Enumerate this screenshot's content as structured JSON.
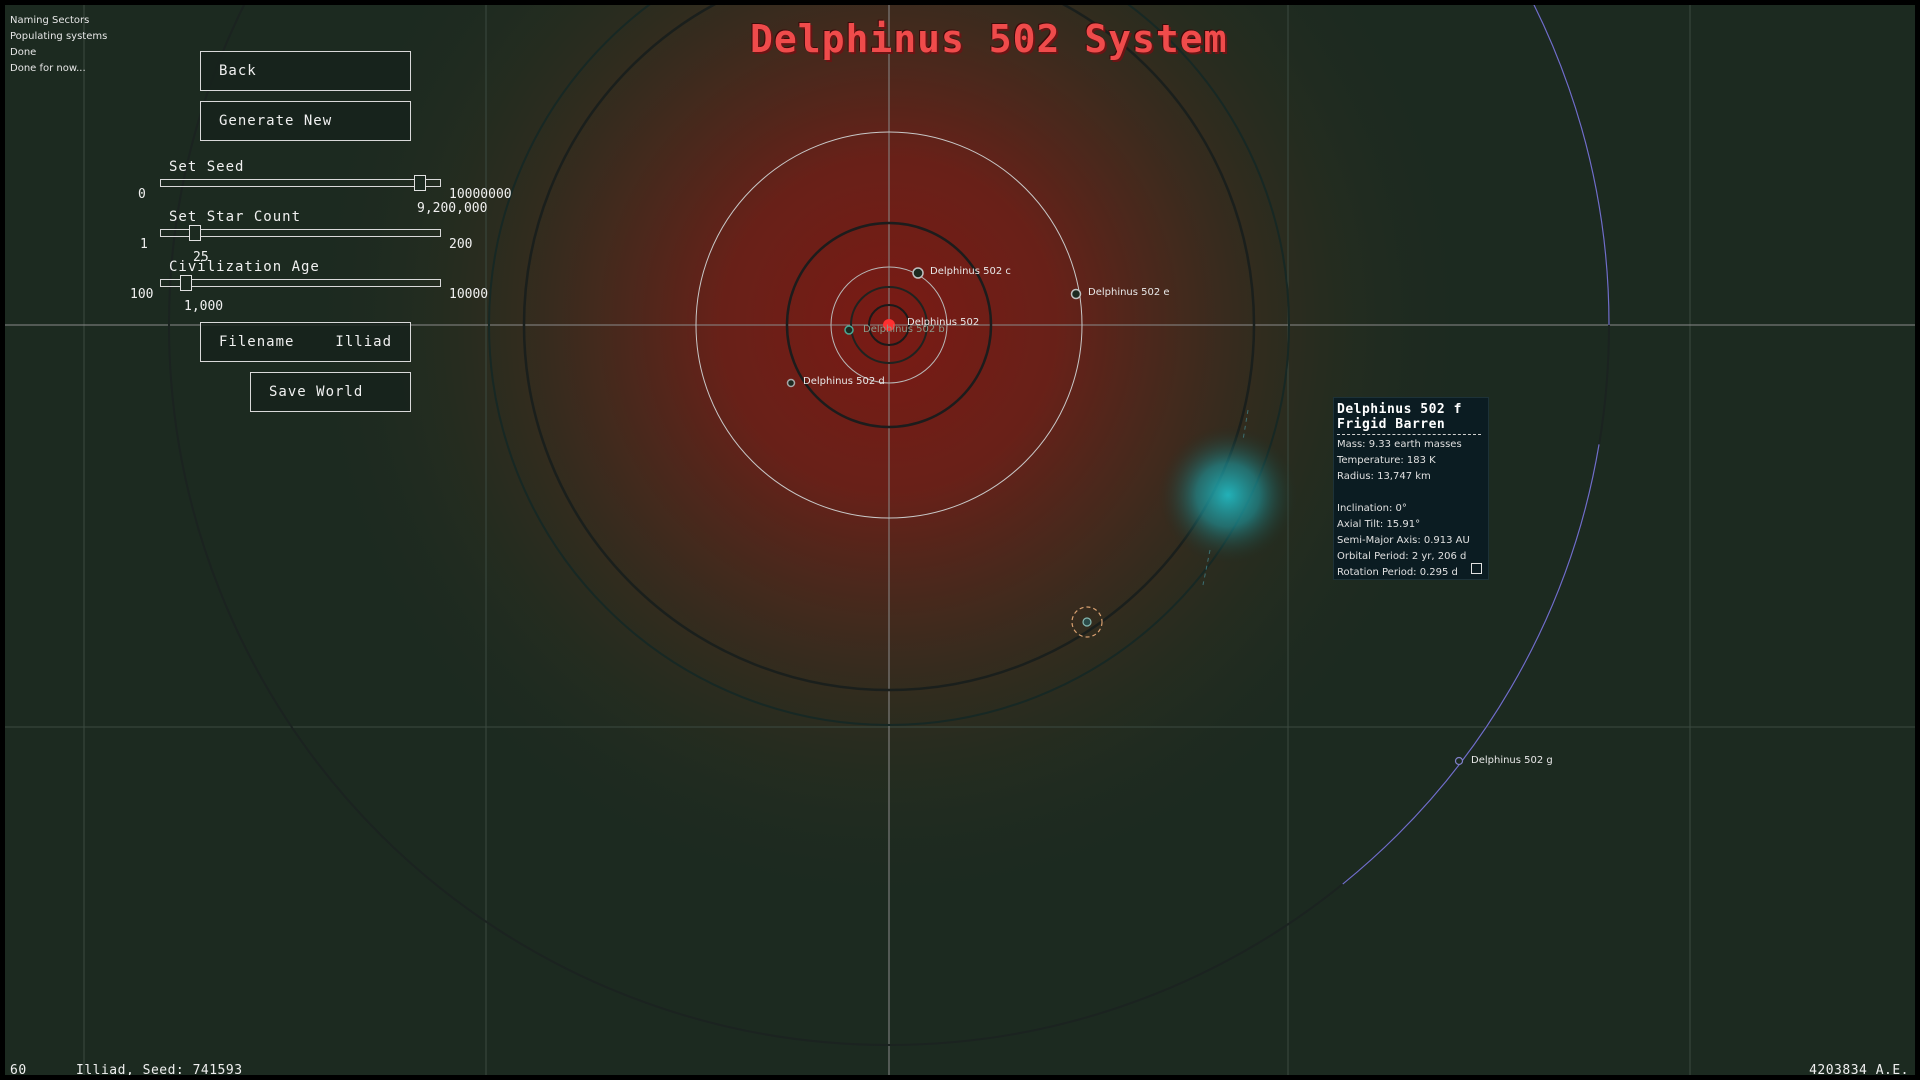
{
  "log": [
    "Naming Sectors",
    "Populating systems",
    "Done",
    "Done for now..."
  ],
  "buttons": {
    "back": "Back",
    "generate_new": "Generate New",
    "filename_label": "Filename",
    "filename_value": "Illiad",
    "save_world": "Save World"
  },
  "sliders": {
    "seed": {
      "label": "Set Seed",
      "min": "0",
      "max": "10000000",
      "value": "9,200,000",
      "fraction": 0.92
    },
    "star_count": {
      "label": "Set Star Count",
      "min": "1",
      "max": "200",
      "value": "25",
      "fraction": 0.12
    },
    "civ_age": {
      "label": "Civilization Age",
      "min": "100",
      "max": "10000",
      "value": "1,000",
      "fraction": 0.09
    }
  },
  "title": "Delphinus 502 System",
  "planets": {
    "star": "Delphinus 502",
    "b": "Delphinus 502 b",
    "c": "Delphinus 502 c",
    "d": "Delphinus 502 d",
    "e": "Delphinus 502 e",
    "g": "Delphinus 502 g"
  },
  "info": {
    "name": "Delphinus 502 f",
    "type": "Frigid Barren",
    "mass": "Mass: 9.33 earth masses",
    "temperature": "Temperature: 183 K",
    "radius": "Radius: 13,747 km",
    "inclination": "Inclination: 0°",
    "axial_tilt": "Axial Tilt: 15.91°",
    "semi_major": "Semi-Major Axis: 0.913 AU",
    "orbital_period": "Orbital Period: 2 yr, 206 d",
    "rotation_period": "Rotation Period: 0.295 d"
  },
  "status": {
    "fps": "60",
    "world": "Illiad, Seed: 741593",
    "date": "4203834 A.E."
  },
  "colors": {
    "background": "#1c2a20",
    "title": "#ef4b4b",
    "star": "#ff3030",
    "planet_f_glow": "#22b8c0",
    "orbit_g": "#6f6fc8"
  }
}
